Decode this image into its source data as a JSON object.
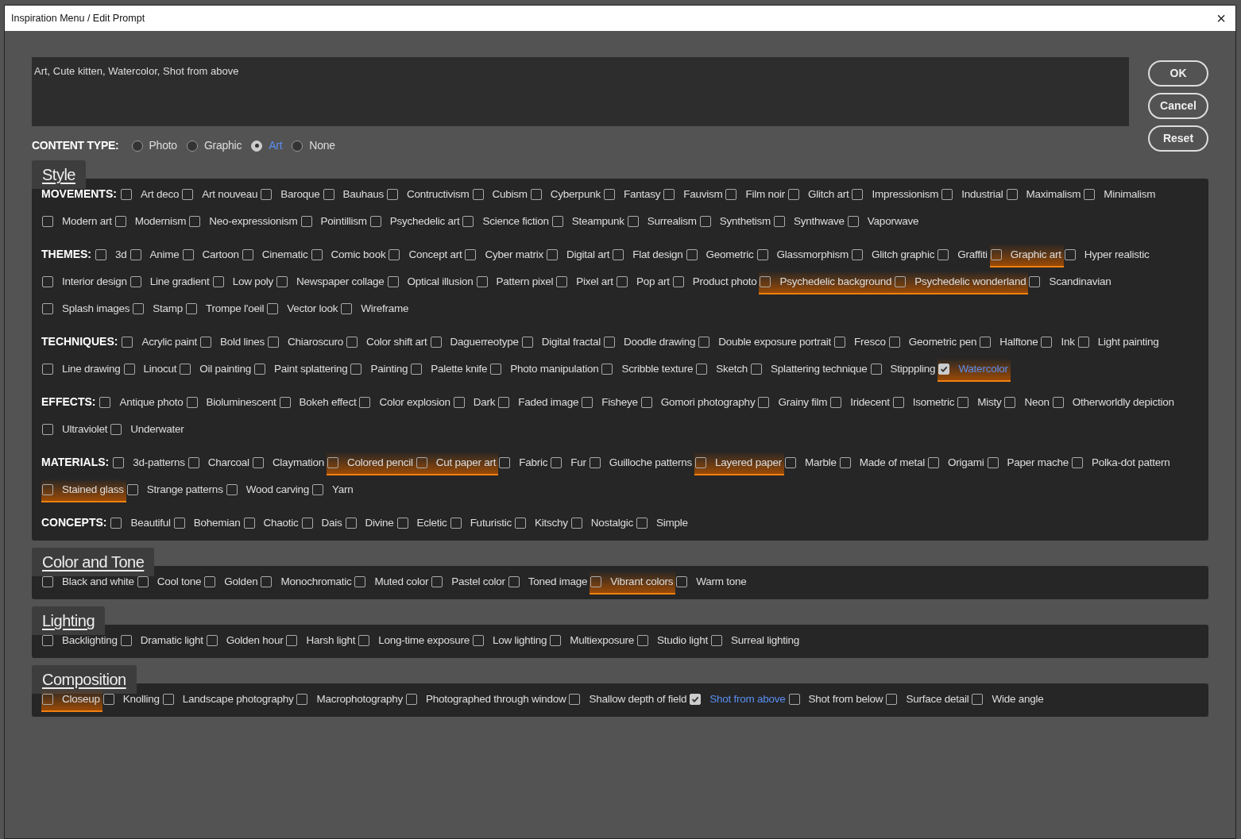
{
  "window": {
    "title": "Inspiration Menu / Edit Prompt",
    "close": "×"
  },
  "prompt": {
    "value": "Art, Cute kitten, Watercolor, Shot from above"
  },
  "buttons": [
    "OK",
    "Cancel",
    "Reset"
  ],
  "content_type": {
    "label": "CONTENT TYPE:",
    "options": [
      {
        "label": "Photo",
        "selected": false
      },
      {
        "label": "Graphic",
        "selected": false
      },
      {
        "label": "Art",
        "selected": true
      },
      {
        "label": "None",
        "selected": false
      }
    ]
  },
  "sections": [
    {
      "title": "Style",
      "groups": [
        {
          "label": "MOVEMENTS:",
          "items": [
            {
              "label": "Art deco",
              "checked": false,
              "highlighted": false
            },
            {
              "label": "Art nouveau",
              "checked": false,
              "highlighted": false
            },
            {
              "label": "Baroque",
              "checked": false,
              "highlighted": false
            },
            {
              "label": "Bauhaus",
              "checked": false,
              "highlighted": false
            },
            {
              "label": "Contructivism",
              "checked": false,
              "highlighted": false
            },
            {
              "label": "Cubism",
              "checked": false,
              "highlighted": false
            },
            {
              "label": "Cyberpunk",
              "checked": false,
              "highlighted": false
            },
            {
              "label": "Fantasy",
              "checked": false,
              "highlighted": false
            },
            {
              "label": "Fauvism",
              "checked": false,
              "highlighted": false
            },
            {
              "label": "Film noir",
              "checked": false,
              "highlighted": false
            },
            {
              "label": "Glitch art",
              "checked": false,
              "highlighted": false
            },
            {
              "label": "Impressionism",
              "checked": false,
              "highlighted": false
            },
            {
              "label": "Industrial",
              "checked": false,
              "highlighted": false
            },
            {
              "label": "Maximalism",
              "checked": false,
              "highlighted": false
            },
            {
              "label": "Minimalism",
              "checked": false,
              "highlighted": false
            },
            {
              "label": "Modern art",
              "checked": false,
              "highlighted": false
            },
            {
              "label": "Modernism",
              "checked": false,
              "highlighted": false
            },
            {
              "label": "Neo-expressionism",
              "checked": false,
              "highlighted": false
            },
            {
              "label": "Pointillism",
              "checked": false,
              "highlighted": false
            },
            {
              "label": "Psychedelic art",
              "checked": false,
              "highlighted": false
            },
            {
              "label": "Science fiction",
              "checked": false,
              "highlighted": false
            },
            {
              "label": "Steampunk",
              "checked": false,
              "highlighted": false
            },
            {
              "label": "Surrealism",
              "checked": false,
              "highlighted": false
            },
            {
              "label": "Synthetism",
              "checked": false,
              "highlighted": false
            },
            {
              "label": "Synthwave",
              "checked": false,
              "highlighted": false
            },
            {
              "label": "Vaporwave",
              "checked": false,
              "highlighted": false
            }
          ]
        },
        {
          "label": "THEMES:",
          "items": [
            {
              "label": "3d",
              "checked": false,
              "highlighted": false
            },
            {
              "label": "Anime",
              "checked": false,
              "highlighted": false
            },
            {
              "label": "Cartoon",
              "checked": false,
              "highlighted": false
            },
            {
              "label": "Cinematic",
              "checked": false,
              "highlighted": false
            },
            {
              "label": "Comic book",
              "checked": false,
              "highlighted": false
            },
            {
              "label": "Concept art",
              "checked": false,
              "highlighted": false
            },
            {
              "label": "Cyber matrix",
              "checked": false,
              "highlighted": false
            },
            {
              "label": "Digital art",
              "checked": false,
              "highlighted": false
            },
            {
              "label": "Flat design",
              "checked": false,
              "highlighted": false
            },
            {
              "label": "Geometric",
              "checked": false,
              "highlighted": false
            },
            {
              "label": "Glassmorphism",
              "checked": false,
              "highlighted": false
            },
            {
              "label": "Glitch graphic",
              "checked": false,
              "highlighted": false
            },
            {
              "label": "Graffiti",
              "checked": false,
              "highlighted": false
            },
            {
              "label": "Graphic art",
              "checked": false,
              "highlighted": true
            },
            {
              "label": "Hyper realistic",
              "checked": false,
              "highlighted": false
            },
            {
              "label": "Interior design",
              "checked": false,
              "highlighted": false
            },
            {
              "label": "Line gradient",
              "checked": false,
              "highlighted": false
            },
            {
              "label": "Low poly",
              "checked": false,
              "highlighted": false
            },
            {
              "label": "Newspaper collage",
              "checked": false,
              "highlighted": false
            },
            {
              "label": "Optical illusion",
              "checked": false,
              "highlighted": false
            },
            {
              "label": "Pattern pixel",
              "checked": false,
              "highlighted": false
            },
            {
              "label": "Pixel art",
              "checked": false,
              "highlighted": false
            },
            {
              "label": "Pop art",
              "checked": false,
              "highlighted": false
            },
            {
              "label": "Product photo",
              "checked": false,
              "highlighted": false
            },
            {
              "label": "Psychedelic background",
              "checked": false,
              "highlighted": true
            },
            {
              "label": "Psychedelic wonderland",
              "checked": false,
              "highlighted": true
            },
            {
              "label": "Scandinavian",
              "checked": false,
              "highlighted": false
            },
            {
              "label": "Splash images",
              "checked": false,
              "highlighted": false
            },
            {
              "label": "Stamp",
              "checked": false,
              "highlighted": false
            },
            {
              "label": "Trompe l'oeil",
              "checked": false,
              "highlighted": false
            },
            {
              "label": "Vector look",
              "checked": false,
              "highlighted": false
            },
            {
              "label": "Wireframe",
              "checked": false,
              "highlighted": false
            }
          ]
        },
        {
          "label": "TECHNIQUES:",
          "items": [
            {
              "label": "Acrylic paint",
              "checked": false,
              "highlighted": false
            },
            {
              "label": "Bold lines",
              "checked": false,
              "highlighted": false
            },
            {
              "label": "Chiaroscuro",
              "checked": false,
              "highlighted": false
            },
            {
              "label": "Color shift art",
              "checked": false,
              "highlighted": false
            },
            {
              "label": "Daguerreotype",
              "checked": false,
              "highlighted": false
            },
            {
              "label": "Digital fractal",
              "checked": false,
              "highlighted": false
            },
            {
              "label": "Doodle drawing",
              "checked": false,
              "highlighted": false
            },
            {
              "label": "Double exposure portrait",
              "checked": false,
              "highlighted": false
            },
            {
              "label": "Fresco",
              "checked": false,
              "highlighted": false
            },
            {
              "label": "Geometric pen",
              "checked": false,
              "highlighted": false
            },
            {
              "label": "Halftone",
              "checked": false,
              "highlighted": false
            },
            {
              "label": "Ink",
              "checked": false,
              "highlighted": false
            },
            {
              "label": "Light painting",
              "checked": false,
              "highlighted": false
            },
            {
              "label": "Line drawing",
              "checked": false,
              "highlighted": false
            },
            {
              "label": "Linocut",
              "checked": false,
              "highlighted": false
            },
            {
              "label": "Oil painting",
              "checked": false,
              "highlighted": false
            },
            {
              "label": "Paint splattering",
              "checked": false,
              "highlighted": false
            },
            {
              "label": "Painting",
              "checked": false,
              "highlighted": false
            },
            {
              "label": "Palette knife",
              "checked": false,
              "highlighted": false
            },
            {
              "label": "Photo manipulation",
              "checked": false,
              "highlighted": false
            },
            {
              "label": "Scribble texture",
              "checked": false,
              "highlighted": false
            },
            {
              "label": "Sketch",
              "checked": false,
              "highlighted": false
            },
            {
              "label": "Splattering technique",
              "checked": false,
              "highlighted": false
            },
            {
              "label": "Stipppling",
              "checked": false,
              "highlighted": false
            },
            {
              "label": "Watercolor",
              "checked": true,
              "highlighted": true
            }
          ]
        },
        {
          "label": "EFFECTS:",
          "items": [
            {
              "label": "Antique photo",
              "checked": false,
              "highlighted": false
            },
            {
              "label": "Bioluminescent",
              "checked": false,
              "highlighted": false
            },
            {
              "label": "Bokeh effect",
              "checked": false,
              "highlighted": false
            },
            {
              "label": "Color explosion",
              "checked": false,
              "highlighted": false
            },
            {
              "label": "Dark",
              "checked": false,
              "highlighted": false
            },
            {
              "label": "Faded image",
              "checked": false,
              "highlighted": false
            },
            {
              "label": "Fisheye",
              "checked": false,
              "highlighted": false
            },
            {
              "label": "Gomori photography",
              "checked": false,
              "highlighted": false
            },
            {
              "label": "Grainy film",
              "checked": false,
              "highlighted": false
            },
            {
              "label": "Iridecent",
              "checked": false,
              "highlighted": false
            },
            {
              "label": "Isometric",
              "checked": false,
              "highlighted": false
            },
            {
              "label": "Misty",
              "checked": false,
              "highlighted": false
            },
            {
              "label": "Neon",
              "checked": false,
              "highlighted": false
            },
            {
              "label": "Otherworldly depiction",
              "checked": false,
              "highlighted": false
            },
            {
              "label": "Ultraviolet",
              "checked": false,
              "highlighted": false
            },
            {
              "label": "Underwater",
              "checked": false,
              "highlighted": false
            }
          ]
        },
        {
          "label": "MATERIALS:",
          "items": [
            {
              "label": "3d-patterns",
              "checked": false,
              "highlighted": false
            },
            {
              "label": "Charcoal",
              "checked": false,
              "highlighted": false
            },
            {
              "label": "Claymation",
              "checked": false,
              "highlighted": false
            },
            {
              "label": "Colored pencil",
              "checked": false,
              "highlighted": true
            },
            {
              "label": "Cut paper art",
              "checked": false,
              "highlighted": true
            },
            {
              "label": "Fabric",
              "checked": false,
              "highlighted": false
            },
            {
              "label": "Fur",
              "checked": false,
              "highlighted": false
            },
            {
              "label": "Guilloche patterns",
              "checked": false,
              "highlighted": false
            },
            {
              "label": "Layered paper",
              "checked": false,
              "highlighted": true
            },
            {
              "label": "Marble",
              "checked": false,
              "highlighted": false
            },
            {
              "label": "Made of metal",
              "checked": false,
              "highlighted": false
            },
            {
              "label": "Origami",
              "checked": false,
              "highlighted": false
            },
            {
              "label": "Paper mache",
              "checked": false,
              "highlighted": false
            },
            {
              "label": "Polka-dot pattern",
              "checked": false,
              "highlighted": false
            },
            {
              "label": "Stained glass",
              "checked": false,
              "highlighted": true
            },
            {
              "label": "Strange patterns",
              "checked": false,
              "highlighted": false
            },
            {
              "label": "Wood carving",
              "checked": false,
              "highlighted": false
            },
            {
              "label": "Yarn",
              "checked": false,
              "highlighted": false
            }
          ]
        },
        {
          "label": "CONCEPTS:",
          "items": [
            {
              "label": "Beautiful",
              "checked": false,
              "highlighted": false
            },
            {
              "label": "Bohemian",
              "checked": false,
              "highlighted": false
            },
            {
              "label": "Chaotic",
              "checked": false,
              "highlighted": false
            },
            {
              "label": "Dais",
              "checked": false,
              "highlighted": false
            },
            {
              "label": "Divine",
              "checked": false,
              "highlighted": false
            },
            {
              "label": "Ecletic",
              "checked": false,
              "highlighted": false
            },
            {
              "label": "Futuristic",
              "checked": false,
              "highlighted": false
            },
            {
              "label": "Kitschy",
              "checked": false,
              "highlighted": false
            },
            {
              "label": "Nostalgic",
              "checked": false,
              "highlighted": false
            },
            {
              "label": "Simple",
              "checked": false,
              "highlighted": false
            }
          ]
        }
      ]
    },
    {
      "title": "Color and Tone",
      "groups": [
        {
          "items": [
            {
              "label": "Black and white",
              "checked": false,
              "highlighted": false
            },
            {
              "label": "Cool tone",
              "checked": false,
              "highlighted": false
            },
            {
              "label": "Golden",
              "checked": false,
              "highlighted": false
            },
            {
              "label": "Monochromatic",
              "checked": false,
              "highlighted": false
            },
            {
              "label": "Muted color",
              "checked": false,
              "highlighted": false
            },
            {
              "label": "Pastel color",
              "checked": false,
              "highlighted": false
            },
            {
              "label": "Toned image",
              "checked": false,
              "highlighted": false
            },
            {
              "label": "Vibrant colors",
              "checked": false,
              "highlighted": true
            },
            {
              "label": "Warm tone",
              "checked": false,
              "highlighted": false
            }
          ]
        }
      ]
    },
    {
      "title": "Lighting",
      "groups": [
        {
          "items": [
            {
              "label": "Backlighting",
              "checked": false,
              "highlighted": false
            },
            {
              "label": "Dramatic light",
              "checked": false,
              "highlighted": false
            },
            {
              "label": "Golden hour",
              "checked": false,
              "highlighted": false
            },
            {
              "label": "Harsh light",
              "checked": false,
              "highlighted": false
            },
            {
              "label": "Long-time exposure",
              "checked": false,
              "highlighted": false
            },
            {
              "label": "Low lighting",
              "checked": false,
              "highlighted": false
            },
            {
              "label": "Multiexposure",
              "checked": false,
              "highlighted": false
            },
            {
              "label": "Studio light",
              "checked": false,
              "highlighted": false
            },
            {
              "label": "Surreal lighting",
              "checked": false,
              "highlighted": false
            }
          ]
        }
      ]
    },
    {
      "title": "Composition",
      "groups": [
        {
          "items": [
            {
              "label": "Closeup",
              "checked": false,
              "highlighted": true
            },
            {
              "label": "Knolling",
              "checked": false,
              "highlighted": false
            },
            {
              "label": "Landscape photography",
              "checked": false,
              "highlighted": false
            },
            {
              "label": "Macrophotography",
              "checked": false,
              "highlighted": false
            },
            {
              "label": "Photographed through window",
              "checked": false,
              "highlighted": false
            },
            {
              "label": "Shallow depth of field",
              "checked": false,
              "highlighted": false
            },
            {
              "label": "Shot from above",
              "checked": true,
              "highlighted": false
            },
            {
              "label": "Shot from below",
              "checked": false,
              "highlighted": false
            },
            {
              "label": "Surface detail",
              "checked": false,
              "highlighted": false
            },
            {
              "label": "Wide angle",
              "checked": false,
              "highlighted": false
            }
          ]
        }
      ]
    }
  ]
}
